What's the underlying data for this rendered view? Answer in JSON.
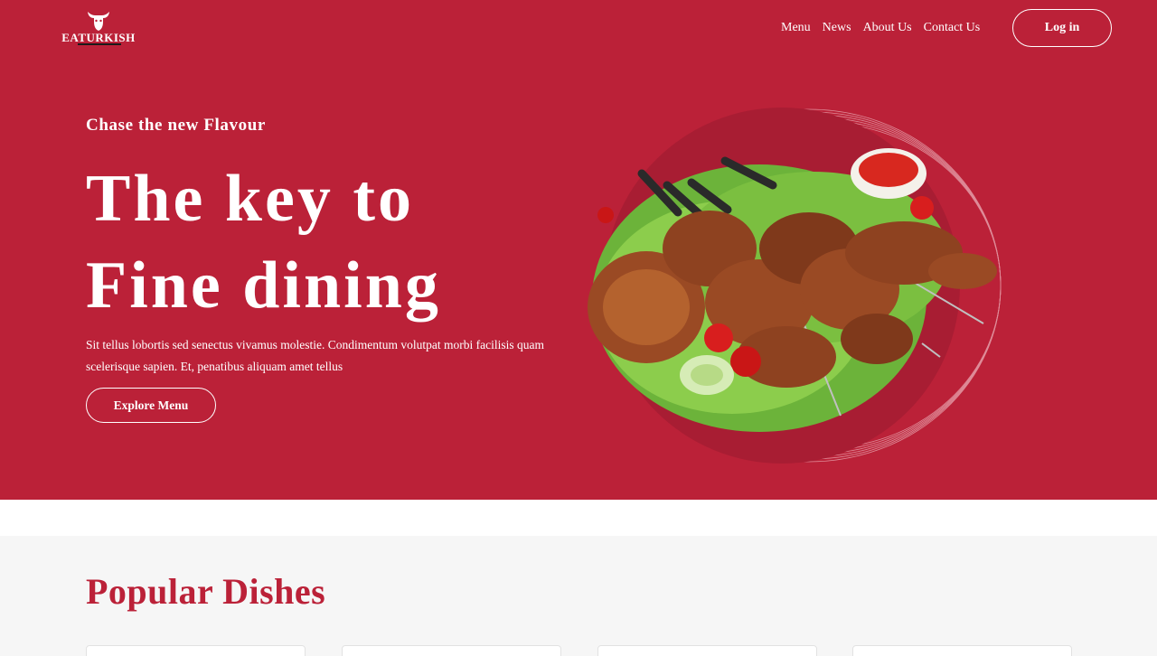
{
  "brand": {
    "logo_text": "EATURKISH"
  },
  "nav": {
    "items": [
      {
        "label": "Menu"
      },
      {
        "label": "News"
      },
      {
        "label": "About Us"
      },
      {
        "label": "Contact Us"
      }
    ],
    "login_label": "Log in"
  },
  "hero": {
    "eyebrow": "Chase the new Flavour",
    "headline_line1": "The key to",
    "headline_line2": "Fine dining",
    "description": "Sit tellus lobortis sed senectus vivamus molestie. Condimentum volutpat morbi facilisis quam scelerisque sapien. Et, penatibus aliquam amet tellus",
    "cta_label": "Explore Menu"
  },
  "popular": {
    "title": "Popular Dishes"
  },
  "colors": {
    "brand_red": "#bb2138",
    "section_bg": "#f6f6f6"
  },
  "icons": {
    "logo": "bull-head-icon",
    "hero_image": "kebab-plate-image"
  }
}
